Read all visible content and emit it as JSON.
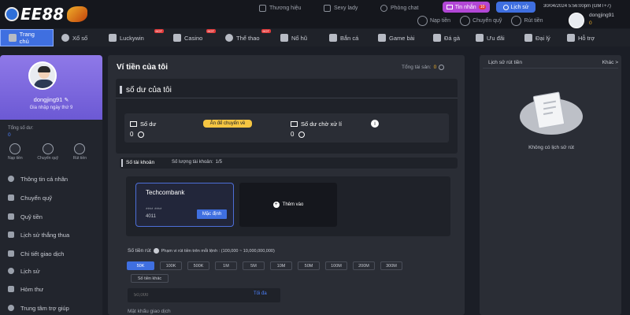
{
  "header": {
    "logo_text": "EE88",
    "links": [
      {
        "label": "Thương hiệu",
        "icon": "brand-icon"
      },
      {
        "label": "Sexy lady",
        "icon": "heart-icon"
      },
      {
        "label": "Phòng chat",
        "icon": "chat-icon"
      }
    ],
    "inbox_label": "Tin nhắn",
    "inbox_badge": "10",
    "history_label": "Lịch sử",
    "datetime": "30/04/2024 5:56:00pm (GMT+7)",
    "username": "dongjing91",
    "balance": "0",
    "wallet_actions": [
      {
        "label": "Nạp tiền",
        "icon": "deposit-icon"
      },
      {
        "label": "Chuyển quỹ",
        "icon": "transfer-icon"
      },
      {
        "label": "Rút tiền",
        "icon": "withdraw-icon"
      }
    ],
    "brand_color": "#3f6fe0"
  },
  "nav": [
    {
      "label": "Trang chủ",
      "icon": "home-icon",
      "active": true
    },
    {
      "label": "Xổ số",
      "icon": "lottery-icon"
    },
    {
      "label": "Luckywin",
      "icon": "luckywin-icon",
      "hot": "HOT"
    },
    {
      "label": "Casino",
      "icon": "casino-icon",
      "hot": "HOT"
    },
    {
      "label": "Thể thao",
      "icon": "sports-icon",
      "hot": "HOT"
    },
    {
      "label": "Nổ hũ",
      "icon": "slots-icon"
    },
    {
      "label": "Bắn cá",
      "icon": "fish-icon"
    },
    {
      "label": "Game bài",
      "icon": "cards-icon"
    },
    {
      "label": "Đá gà",
      "icon": "cockfight-icon"
    },
    {
      "label": "Ưu đãi",
      "icon": "gift-icon"
    },
    {
      "label": "Đại lý",
      "icon": "agent-icon"
    },
    {
      "label": "Hỗ trợ",
      "icon": "support-icon"
    }
  ],
  "profile": {
    "username": "dongjing91",
    "days_joined": "Gia nhập ngày thứ 9",
    "total_balance_label": "Tổng số dư:",
    "total_balance_value": "0",
    "quick_actions": [
      {
        "label": "Nạp tiền",
        "icon": "deposit-icon"
      },
      {
        "label": "Chuyển quỹ",
        "icon": "transfer-icon"
      },
      {
        "label": "Rút tiền",
        "icon": "withdraw-icon"
      }
    ],
    "menu": [
      {
        "label": "Thông tin cá nhân",
        "icon": "user-icon"
      },
      {
        "label": "Chuyển quỹ",
        "icon": "transfer-icon"
      },
      {
        "label": "Quỹ tiền",
        "icon": "fund-icon"
      },
      {
        "label": "Lịch sử thắng thua",
        "icon": "history-icon"
      },
      {
        "label": "Chi tiết giao dịch",
        "icon": "detail-icon"
      },
      {
        "label": "Lịch sử",
        "icon": "clock-icon"
      },
      {
        "label": "Hòm thư",
        "icon": "mail-icon"
      },
      {
        "label": "Trung tâm trợ giúp",
        "icon": "help-icon"
      }
    ]
  },
  "wallet": {
    "title": "Ví tiền của tôi",
    "total_assets_label": "Tổng tài sản:",
    "total_assets_value": "0",
    "balance_section_title": "số dư của tôi",
    "balance_label": "Số dư",
    "balance_value": "0",
    "hide_transfer_label": "Ẩn để chuyển về",
    "pending_label": "Số dư chờ xử lí",
    "pending_value": "0",
    "accounts_tab": "Số tài khoản",
    "accounts_count_label": "Số lượng tài khoản:",
    "accounts_count": "1/5",
    "bank_name": "Techcombank",
    "card_masked": "**** ****",
    "card_last4": "4011",
    "default_label": "Mặc định",
    "add_label": "Thêm vào",
    "amount_label": "Số tiền rút",
    "amount_range": "Phạm vi rút tiền trên mỗi lệnh : (100,000 ~ 10,000,000,000)",
    "amounts": [
      "50K",
      "100K",
      "500K",
      "1M",
      "5M",
      "10M",
      "50M",
      "100M",
      "200M",
      "300M"
    ],
    "other_amount": "Số tiền khác",
    "amount_placeholder": "50,000",
    "max_label": "Tối đa",
    "password_label": "Mật khẩu giao dịch"
  },
  "history": {
    "title": "Lịch sử rút tiền",
    "other": "Khác >",
    "empty": "Không có lịch sử rút"
  }
}
